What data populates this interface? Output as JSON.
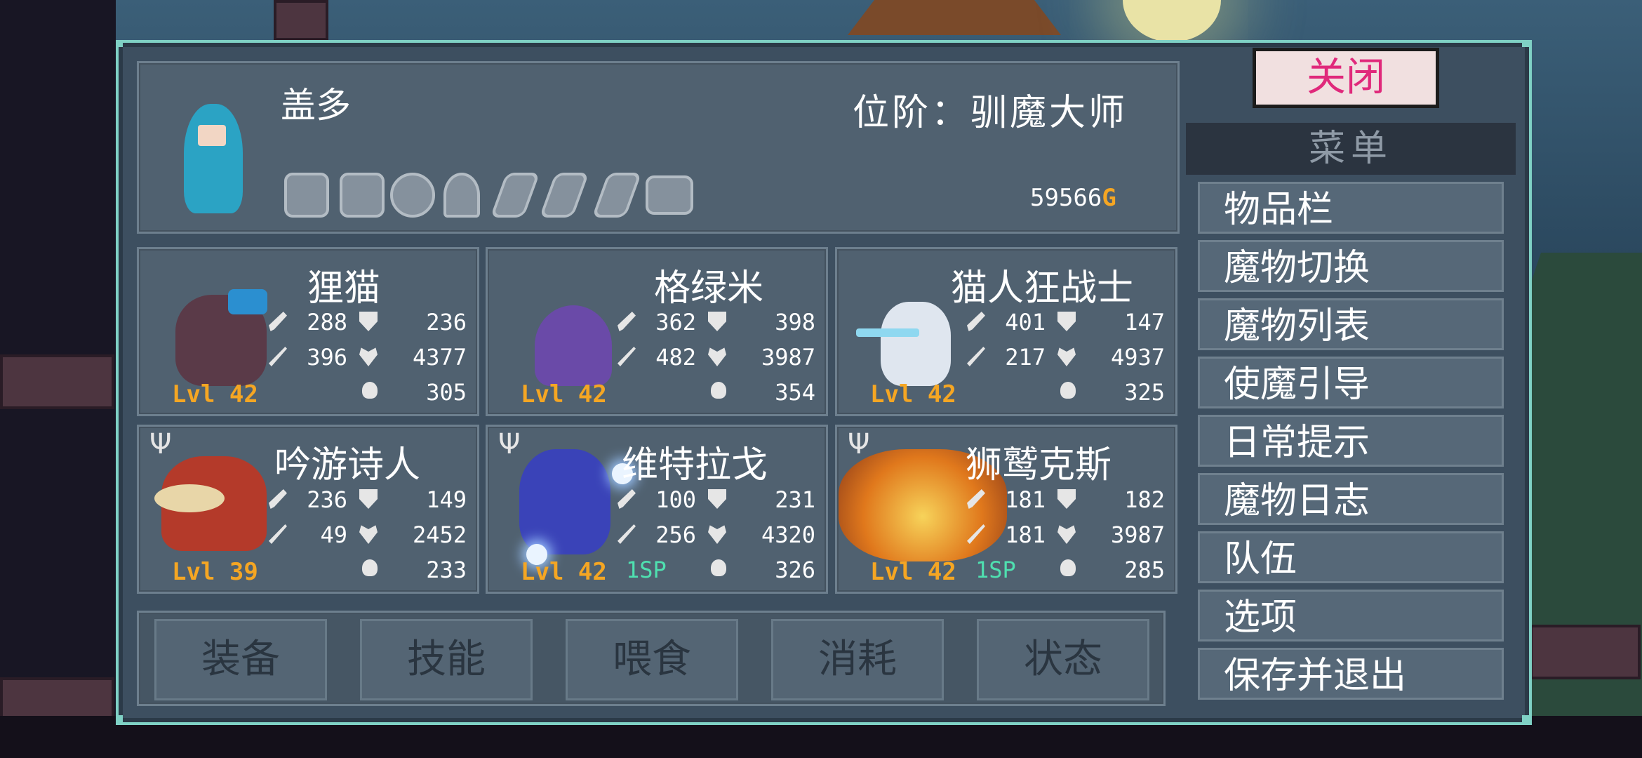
{
  "hero": {
    "name": "盖多",
    "rank": "位阶：驯魔大师",
    "gold": "59566",
    "gold_unit": "G"
  },
  "colors": {
    "panel_border": "#7fd1c5",
    "level": "#f5a623",
    "skill_points": "#4fe0b0",
    "close_text": "#e0297b"
  },
  "monsters": [
    {
      "name": "狸猫",
      "atk": "288",
      "def": "236",
      "mag": "396",
      "hp": "4377",
      "bag": "305",
      "level": "Lvl 42",
      "sp": ""
    },
    {
      "name": "格绿米",
      "atk": "362",
      "def": "398",
      "mag": "482",
      "hp": "3987",
      "bag": "354",
      "level": "Lvl 42",
      "sp": ""
    },
    {
      "name": "猫人狂战士",
      "atk": "401",
      "def": "147",
      "mag": "217",
      "hp": "4937",
      "bag": "325",
      "level": "Lvl 42",
      "sp": ""
    },
    {
      "name": "吟游诗人",
      "atk": "236",
      "def": "149",
      "mag": "49",
      "hp": "2452",
      "bag": "233",
      "level": "Lvl 39",
      "sp": ""
    },
    {
      "name": "维特拉戈",
      "atk": "100",
      "def": "231",
      "mag": "256",
      "hp": "4320",
      "bag": "326",
      "level": "Lvl 42",
      "sp": "1SP"
    },
    {
      "name": "狮鹫克斯",
      "atk": "181",
      "def": "182",
      "mag": "181",
      "hp": "3987",
      "bag": "285",
      "level": "Lvl 42",
      "sp": "1SP"
    }
  ],
  "actions": [
    "装备",
    "技能",
    "喂食",
    "消耗",
    "状态"
  ],
  "menu": {
    "close": "关闭",
    "title": "菜单",
    "items": [
      "物品栏",
      "魔物切换",
      "魔物列表",
      "使魔引导",
      "日常提示",
      "魔物日志",
      "队伍",
      "选项",
      "保存并退出"
    ]
  }
}
